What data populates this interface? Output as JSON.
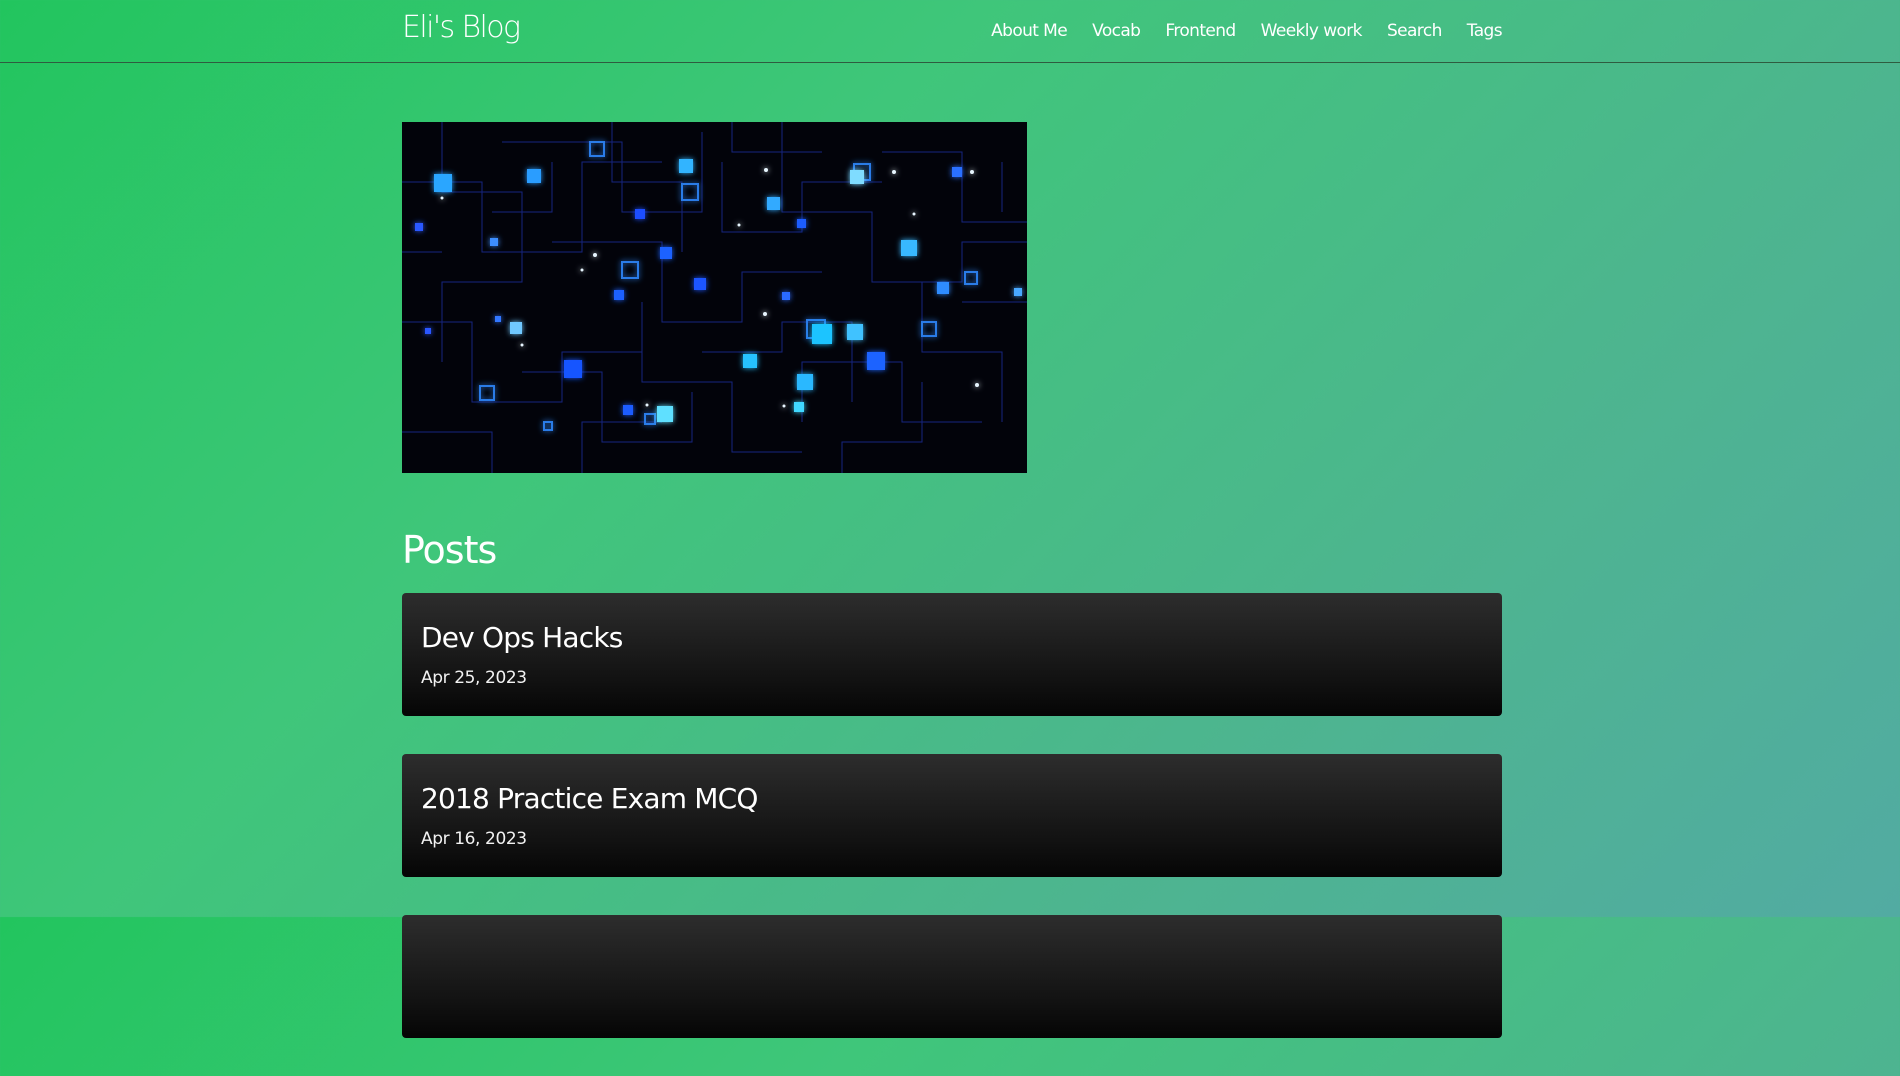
{
  "header": {
    "site_title": "Eli's Blog",
    "nav": [
      {
        "label": "About Me"
      },
      {
        "label": "Vocab"
      },
      {
        "label": "Frontend"
      },
      {
        "label": "Weekly work"
      },
      {
        "label": "Search"
      },
      {
        "label": "Tags"
      }
    ]
  },
  "main": {
    "posts_heading": "Posts",
    "posts": [
      {
        "title": "Dev Ops Hacks",
        "date": "Apr 25, 2023"
      },
      {
        "title": "2018 Practice Exam MCQ",
        "date": "Apr 16, 2023"
      },
      {
        "title": "",
        "date": ""
      }
    ]
  },
  "colors": {
    "background_start": "#22c55e",
    "background_end": "#52aba2",
    "card_top": "#2d2d2d",
    "card_bottom": "#050505",
    "hero_glow": "#2ea8ff"
  }
}
